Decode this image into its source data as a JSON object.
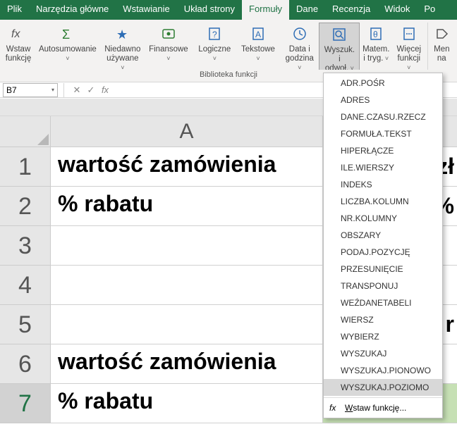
{
  "tabs": {
    "plik": "Plik",
    "narzedzia": "Narzędzia główne",
    "wstawianie": "Wstawianie",
    "uklad": "Układ strony",
    "formuly": "Formuły",
    "dane": "Dane",
    "recenzja": "Recenzja",
    "widok": "Widok",
    "po": "Po"
  },
  "ribbon": {
    "wstaw1": "Wstaw",
    "wstaw2": "funkcję",
    "autosum": "Autosumowanie",
    "niedawno1": "Niedawno",
    "niedawno2": "używane",
    "finansowe": "Finansowe",
    "logiczne": "Logiczne",
    "tekstowe": "Tekstowe",
    "data1": "Data i",
    "data2": "godzina",
    "wyszuk1": "Wyszuk. i",
    "wyszuk2": "odwoł.",
    "matem1": "Matem.",
    "matem2": "i tryg.",
    "wiecej1": "Więcej",
    "wiecej2": "funkcji",
    "men1": "Men",
    "men2": "na",
    "grouplabel": "Biblioteka funkcji"
  },
  "fbar": {
    "namebox": "B7",
    "fx_label": "fx"
  },
  "columns": {
    "A": "A"
  },
  "rows": [
    "1",
    "2",
    "3",
    "4",
    "5",
    "6",
    "7"
  ],
  "cells": {
    "A1": "wartość zamówienia",
    "A2": "% rabatu",
    "A3": "",
    "A4": "",
    "A5": "",
    "A6": "wartość zamówienia",
    "A7": "% rabatu"
  },
  "cellsB": {
    "B1": "zł",
    "B2": "%",
    "B5": "r"
  },
  "dropdown": {
    "items": [
      "ADR.POŚR",
      "ADRES",
      "DANE.CZASU.RZECZ",
      "FORMUŁA.TEKST",
      "HIPERŁĄCZE",
      "ILE.WIERSZY",
      "INDEKS",
      "LICZBA.KOLUMN",
      "NR.KOLUMNY",
      "OBSZARY",
      "PODAJ.POZYCJĘ",
      "PRZESUNIĘCIE",
      "TRANSPONUJ",
      "WEŹDANETABELI",
      "WIERSZ",
      "WYBIERZ",
      "WYSZUKAJ",
      "WYSZUKAJ.PIONOWO",
      "WYSZUKAJ.POZIOMO"
    ],
    "highlight": "WYSZUKAJ.POZIOMO",
    "insert_label": "Wstaw funkcję...",
    "fx": "fx"
  }
}
